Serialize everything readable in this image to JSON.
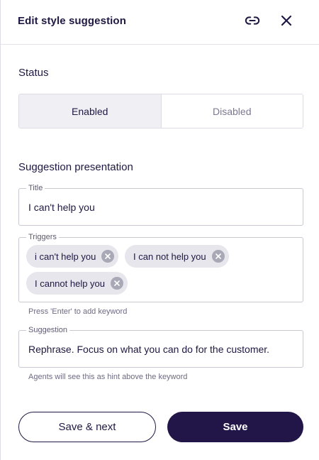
{
  "header": {
    "title": "Edit style suggestion",
    "link_icon": "link-icon",
    "close_icon": "close-icon"
  },
  "status": {
    "title": "Status",
    "options": [
      "Enabled",
      "Disabled"
    ],
    "selected": "Enabled"
  },
  "presentation": {
    "title": "Suggestion presentation",
    "title_field": {
      "legend": "Title",
      "value": "I can't help you"
    },
    "triggers_field": {
      "legend": "Triggers",
      "chips": [
        "i can't help you",
        "I can not help you",
        "I cannot help you"
      ],
      "helper": "Press 'Enter' to add keyword"
    },
    "suggestion_field": {
      "legend": "Suggestion",
      "value": "Rephrase. Focus on what you can do for the customer.",
      "helper": "Agents will see this as hint above the keyword"
    }
  },
  "actions": {
    "save_next_label": "Save & next",
    "save_label": "Save"
  },
  "colors": {
    "primary": "#221548",
    "text": "#1f1842",
    "chip_bg": "#e6e6ec",
    "segment_active_bg": "#efeff4"
  }
}
